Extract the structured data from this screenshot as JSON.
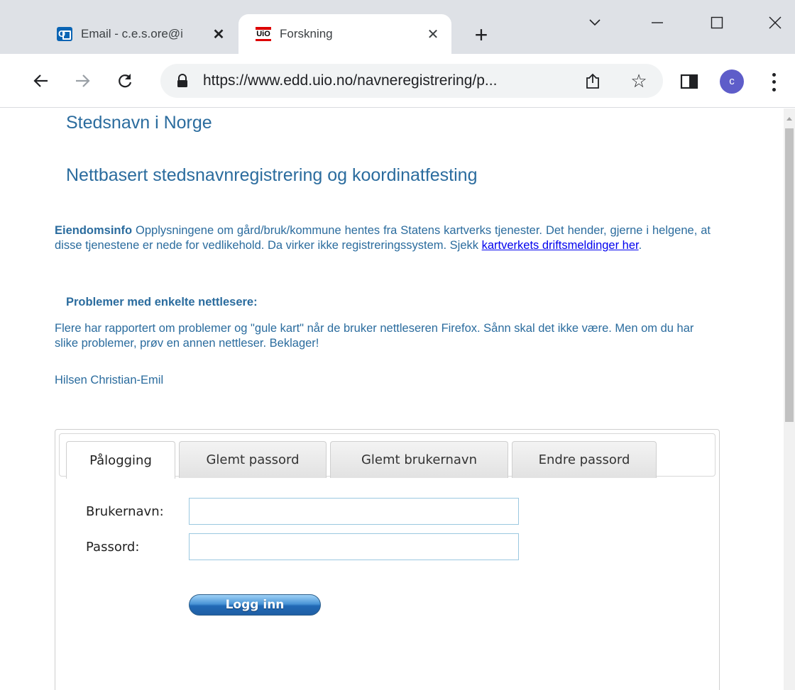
{
  "browser": {
    "tabs": [
      {
        "title": "Email - c.e.s.ore@i",
        "favicon": "outlook-icon",
        "active": false
      },
      {
        "title": "Forskning",
        "favicon": "uio-icon",
        "active": true
      }
    ],
    "url": "https://www.edd.uio.no/navneregistrering/p...",
    "profile_initial": "c",
    "profile_color": "#5e5dc9"
  },
  "page": {
    "title": "Stedsnavn i Norge",
    "subtitle": "Nettbasert stedsnavnregistrering og koordinatfesting",
    "notice": {
      "label": "Eiendomsinfo",
      "text": " Opplysningene om gård/bruk/kommune hentes fra Statens kartverks tjenester. Det hender, gjerne i helgene, at disse tjenestene er nede for vedlikehold. Da virker ikke registreringssystem. Sjekk ",
      "link_text": "kartverkets driftsmeldinger her",
      "after_link": "."
    },
    "problems_heading": "Problemer med enkelte nettlesere:",
    "problems_text": "Flere har rapportert om problemer og \"gule kart\" når de bruker nettleseren Firefox. Sånn skal det ikke være. Men om du har slike problemer, prøv en annen nettleser. Beklager!",
    "greeting": "Hilsen Christian-Emil",
    "text_color": "#2b6c9e"
  },
  "login": {
    "tabs": [
      "Pålogging",
      "Glemt passord",
      "Glemt brukernavn",
      "Endre passord"
    ],
    "active_tab": 0,
    "username_label": "Brukernavn:",
    "username_value": "",
    "password_label": "Passord:",
    "password_value": "",
    "submit_label": "Logg inn"
  }
}
